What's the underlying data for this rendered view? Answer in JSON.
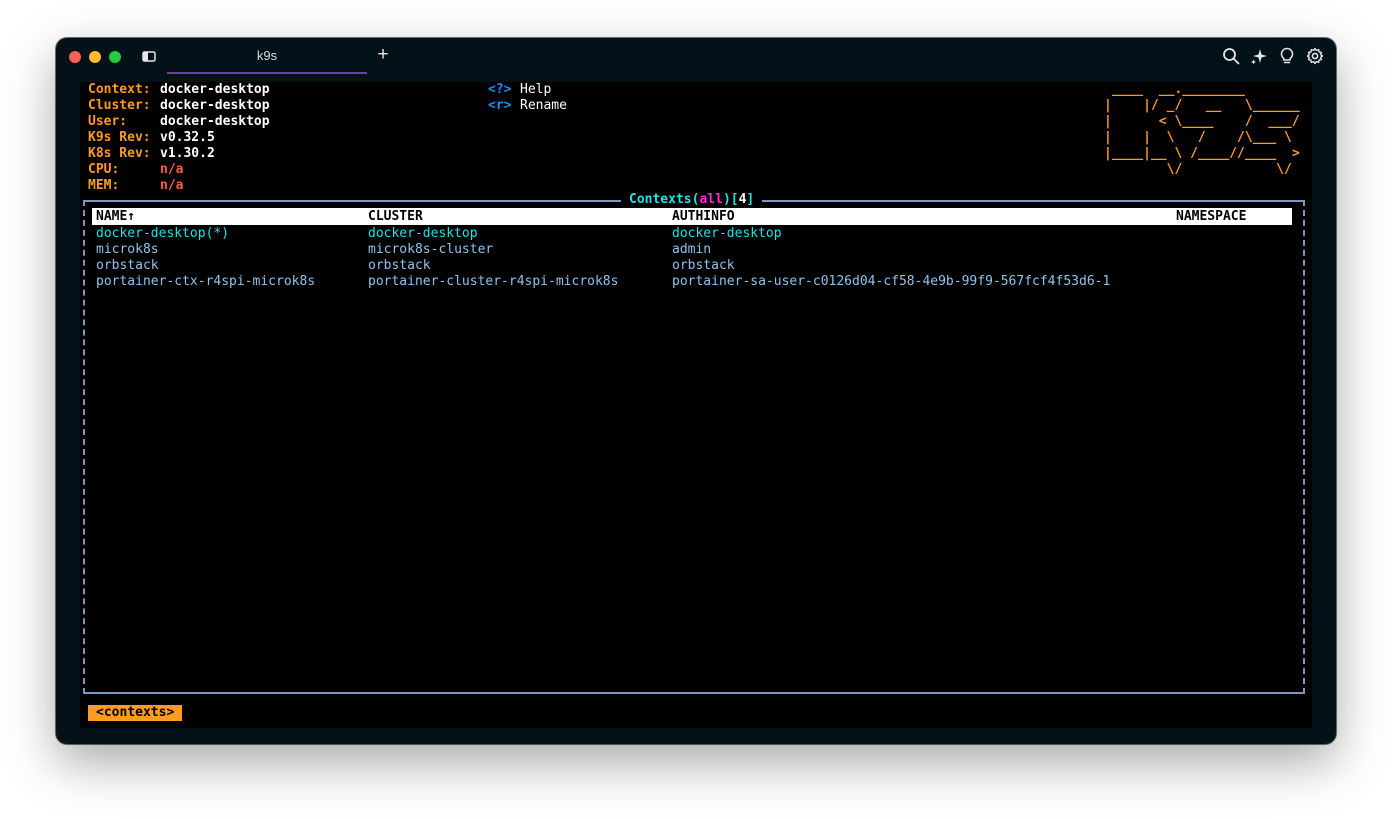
{
  "window": {
    "tab_title": "k9s",
    "new_tab_label": "+",
    "icons": [
      "sidebar-toggle-icon",
      "search-icon",
      "ai-sparkle-icon",
      "lightbulb-icon",
      "gear-icon"
    ]
  },
  "info": [
    {
      "label": "Context:",
      "value": "docker-desktop",
      "value_color": "white"
    },
    {
      "label": "Cluster:",
      "value": "docker-desktop",
      "value_color": "white"
    },
    {
      "label": "User:",
      "value": "docker-desktop",
      "value_color": "white"
    },
    {
      "label": "K9s Rev:",
      "value": "v0.32.5",
      "value_color": "white"
    },
    {
      "label": "K8s Rev:",
      "value": "v1.30.2",
      "value_color": "white"
    },
    {
      "label": "CPU:",
      "value": "n/a",
      "value_color": "red"
    },
    {
      "label": "MEM:",
      "value": "n/a",
      "value_color": "red"
    }
  ],
  "shortcuts": [
    {
      "key": "<?>",
      "action": "Help"
    },
    {
      "key": "<r>",
      "action": "Rename"
    }
  ],
  "logo_lines": [
    " ____  __.________       ",
    "|    |/ _/   __   \\______",
    "|      < \\____    /  ___/",
    "|    |  \\   /    /\\___ \\ ",
    "|____|__ \\ /____//____  >",
    "        \\/            \\/ "
  ],
  "panel": {
    "title": "Contexts",
    "filter": "all",
    "count": "4"
  },
  "table": {
    "columns": [
      "NAME↑",
      "CLUSTER",
      "AUTHINFO",
      "NAMESPACE"
    ],
    "rows": [
      {
        "name": "docker-desktop(*)",
        "cluster": "docker-desktop",
        "authinfo": "docker-desktop",
        "namespace": "",
        "active": true
      },
      {
        "name": "microk8s",
        "cluster": "microk8s-cluster",
        "authinfo": "admin",
        "namespace": "",
        "active": false
      },
      {
        "name": "orbstack",
        "cluster": "orbstack",
        "authinfo": "orbstack",
        "namespace": "",
        "active": false
      },
      {
        "name": "portainer-ctx-r4spi-microk8s",
        "cluster": "portainer-cluster-r4spi-microk8s",
        "authinfo": "portainer-sa-user-c0126d04-cf58-4e9b-99f9-567fcf4f53d6-1",
        "namespace": "",
        "active": false
      }
    ]
  },
  "breadcrumb": "<contexts>",
  "colors": {
    "label": "#ff9a22",
    "value": "#ffffff",
    "na": "#ff5a3c",
    "key": "#1e90ff",
    "active_row": "#22e0e8",
    "row": "#8fc3ec",
    "filter": "#ff2bd6",
    "frame": "#7d95bf",
    "tab_underline": "#6a3fb3"
  }
}
